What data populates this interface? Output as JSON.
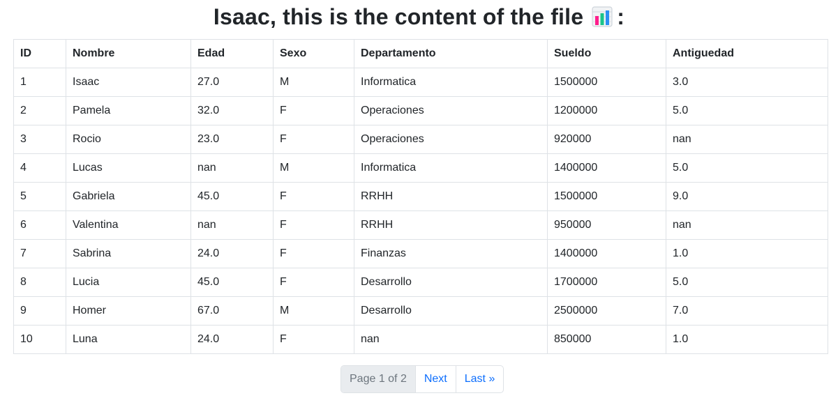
{
  "header": {
    "title": "Isaac, this is the content of the file",
    "icon": "bar-chart-icon",
    "suffix": ":"
  },
  "table": {
    "columns": [
      "ID",
      "Nombre",
      "Edad",
      "Sexo",
      "Departamento",
      "Sueldo",
      "Antiguedad"
    ],
    "rows": [
      [
        "1",
        "Isaac",
        "27.0",
        "M",
        "Informatica",
        "1500000",
        "3.0"
      ],
      [
        "2",
        "Pamela",
        "32.0",
        "F",
        "Operaciones",
        "1200000",
        "5.0"
      ],
      [
        "3",
        "Rocio",
        "23.0",
        "F",
        "Operaciones",
        "920000",
        "nan"
      ],
      [
        "4",
        "Lucas",
        "nan",
        "M",
        "Informatica",
        "1400000",
        "5.0"
      ],
      [
        "5",
        "Gabriela",
        "45.0",
        "F",
        "RRHH",
        "1500000",
        "9.0"
      ],
      [
        "6",
        "Valentina",
        "nan",
        "F",
        "RRHH",
        "950000",
        "nan"
      ],
      [
        "7",
        "Sabrina",
        "24.0",
        "F",
        "Finanzas",
        "1400000",
        "1.0"
      ],
      [
        "8",
        "Lucia",
        "45.0",
        "F",
        "Desarrollo",
        "1700000",
        "5.0"
      ],
      [
        "9",
        "Homer",
        "67.0",
        "M",
        "Desarrollo",
        "2500000",
        "7.0"
      ],
      [
        "10",
        "Luna",
        "24.0",
        "F",
        "nan",
        "850000",
        "1.0"
      ]
    ]
  },
  "pagination": {
    "current": "Page 1 of 2",
    "next": "Next",
    "last": "Last »"
  },
  "colors": {
    "link": "#0d6efd",
    "border": "#dee2e6",
    "current_bg": "#e9ecef"
  }
}
